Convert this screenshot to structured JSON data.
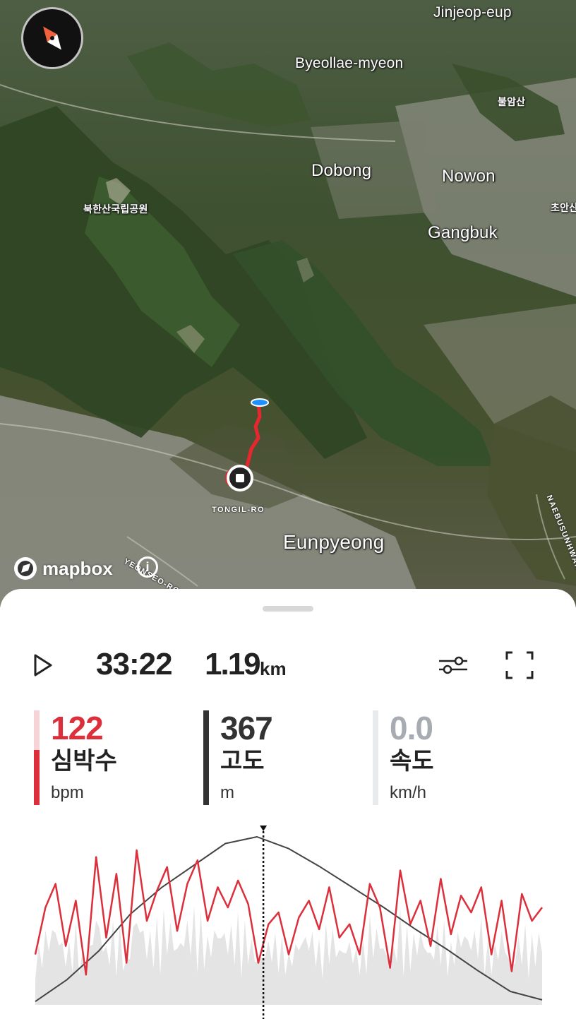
{
  "map": {
    "labels": {
      "jinjeop": "Jinjeop-eup",
      "byeollae": "Byeollae-myeon",
      "bulamsan": "불암산",
      "dobong": "Dobong",
      "nowon": "Nowon",
      "bukhansan": "북한산국립공원",
      "choan": "초안산",
      "gangbuk": "Gangbuk",
      "eunpyeong": "Eunpyeong"
    },
    "roads": {
      "tongil": "TONGIL-RO",
      "yeonseo": "YEONSEO-RO",
      "naebu": "NAEBUSUNHWAN-RO"
    },
    "attribution": "mapbox",
    "info_symbol": "i",
    "compass_icon": "compass-icon",
    "route_color": "#e8262f",
    "start_marker_color": "#1e90ff"
  },
  "playback": {
    "play_icon": "play-icon",
    "elapsed": "33:22",
    "distance": "1.19",
    "distance_unit": "km",
    "settings_icon": "sliders-icon",
    "fullscreen_icon": "fullscreen-icon"
  },
  "metrics": [
    {
      "value": "122",
      "name": "심박수",
      "unit": "bpm",
      "color": "#dc2f3c",
      "bar_fill": 0.58
    },
    {
      "value": "367",
      "name": "고도",
      "unit": "m",
      "color": "#333333",
      "bar_fill": 1.0
    },
    {
      "value": "0.0",
      "name": "속도",
      "unit": "km/h",
      "color": "#a7abb2",
      "bar_fill": 0.0
    }
  ],
  "chart_data": {
    "type": "line",
    "cursor_position": 0.45,
    "series": [
      {
        "values": [
          0.02,
          0.15,
          0.32,
          0.54,
          0.7,
          0.83,
          0.96,
          1.0,
          0.93,
          0.82,
          0.7,
          0.58,
          0.45,
          0.33,
          0.2,
          0.08,
          0.03
        ],
        "color": "#444444"
      },
      {
        "values": [
          0.3,
          0.58,
          0.72,
          0.35,
          0.62,
          0.18,
          0.88,
          0.4,
          0.78,
          0.25,
          0.92,
          0.5,
          0.68,
          0.82,
          0.44,
          0.72,
          0.86,
          0.5,
          0.7,
          0.58,
          0.74,
          0.6,
          0.25,
          0.48,
          0.55,
          0.3,
          0.52,
          0.62,
          0.45,
          0.7,
          0.4,
          0.48,
          0.3,
          0.72,
          0.58,
          0.22,
          0.8,
          0.48,
          0.62,
          0.35,
          0.75,
          0.42,
          0.65,
          0.55,
          0.7,
          0.3,
          0.62,
          0.2,
          0.66,
          0.5,
          0.58
        ],
        "color": "#dc2f3c"
      }
    ]
  }
}
